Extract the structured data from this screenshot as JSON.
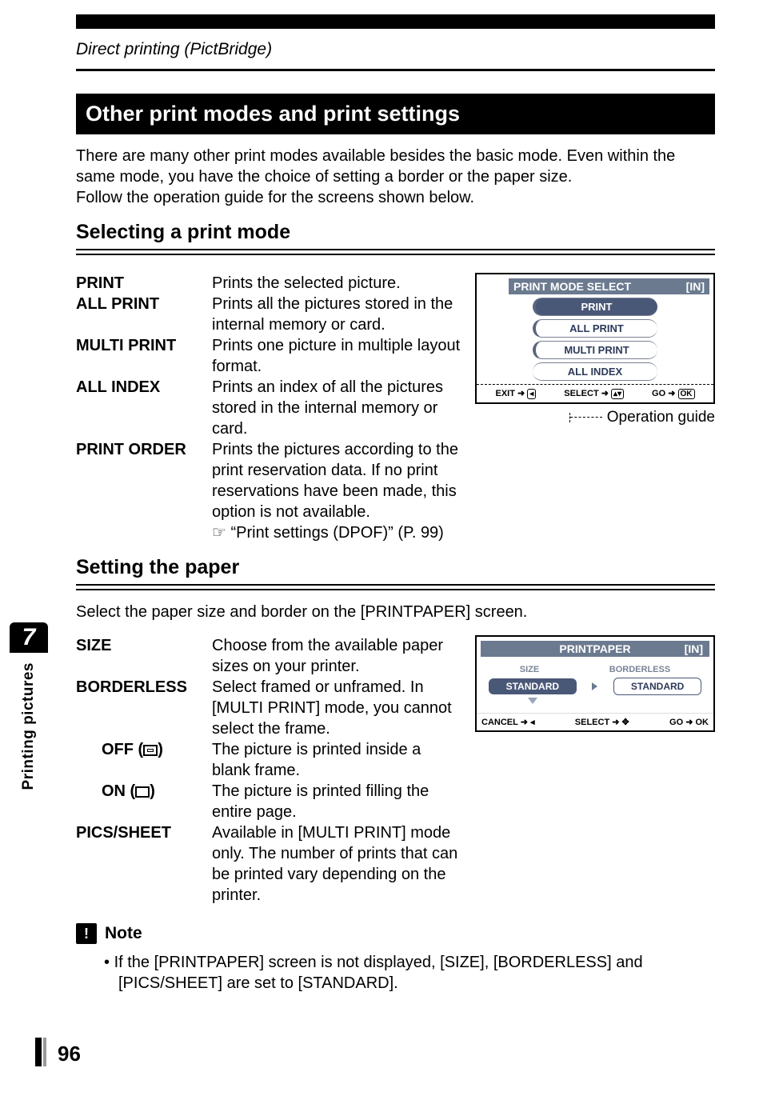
{
  "chapter": "Direct printing (PictBridge)",
  "section_title": "Other print modes and print settings",
  "intro": "There are many other print modes available besides the basic mode. Even within the same mode, you have the choice of setting a border or the paper size.\nFollow the operation guide for the screens shown below.",
  "sub1_title": "Selecting a print mode",
  "modes": {
    "print": {
      "term": "PRINT",
      "desc": "Prints the selected picture."
    },
    "all_print": {
      "term": "ALL PRINT",
      "desc": "Prints all the pictures stored in the internal memory or card."
    },
    "multi": {
      "term": "MULTI PRINT",
      "desc": "Prints one picture in multiple layout format."
    },
    "all_index": {
      "term": "ALL INDEX",
      "desc": "Prints an index of all the pictures stored in the internal memory or card."
    },
    "order": {
      "term": "PRINT ORDER",
      "desc": "Prints the pictures according to the print reservation data. If no print reservations have been made, this option is not available."
    },
    "order_ref": "☞ “Print settings (DPOF)” (P. 99)"
  },
  "lcd1": {
    "title": "PRINT MODE SELECT",
    "in_tag": "[IN]",
    "items": [
      "PRINT",
      "ALL PRINT",
      "MULTI PRINT",
      "ALL INDEX"
    ],
    "footer": {
      "exit": "EXIT",
      "select": "SELECT",
      "go": "GO",
      "ok": "OK"
    },
    "caption": "Operation guide"
  },
  "sub2_title": "Setting the paper",
  "sub2_intro": "Select the paper size and border on the [PRINTPAPER] screen.",
  "paper": {
    "size": {
      "term": "SIZE",
      "desc": "Choose from the available paper sizes on your printer."
    },
    "borderless": {
      "term": "BORDERLESS",
      "desc": "Select framed or unframed. In [MULTI PRINT] mode, you cannot select the frame."
    },
    "off": {
      "term": "OFF (",
      "close": ")",
      "desc": "The picture is printed inside a blank frame."
    },
    "on": {
      "term": "ON (",
      "close": ")",
      "desc": "The picture is printed filling the entire page."
    },
    "pics": {
      "term": "PICS/SHEET",
      "desc": "Available in [MULTI PRINT] mode only. The number of prints that can be printed vary depending on the printer."
    }
  },
  "lcd2": {
    "title": "PRINTPAPER",
    "in_tag": "[IN]",
    "col1": "SIZE",
    "col2": "BORDERLESS",
    "val1": "STANDARD",
    "val2": "STANDARD",
    "footer": {
      "cancel": "CANCEL",
      "select": "SELECT",
      "go": "GO",
      "ok": "OK"
    }
  },
  "note": {
    "label": "Note",
    "bullet": "If the [PRINTPAPER] screen is not displayed, [SIZE], [BORDERLESS] and [PICS/SHEET] are set to [STANDARD]."
  },
  "side": {
    "num": "7",
    "label": "Printing pictures"
  },
  "page_num": "96"
}
